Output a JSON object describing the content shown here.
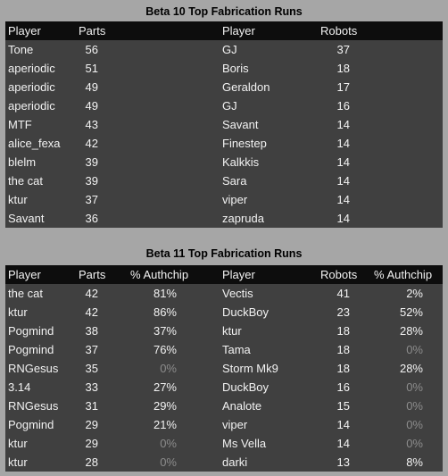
{
  "beta10": {
    "title": "Beta 10 Top Fabrication Runs",
    "headers": {
      "player": "Player",
      "parts": "Parts",
      "player2": "Player",
      "robots": "Robots"
    },
    "rows": [
      {
        "player": "Tone",
        "parts": "56",
        "player2": "GJ",
        "robots": "37"
      },
      {
        "player": "aperiodic",
        "parts": "51",
        "player2": "Boris",
        "robots": "18"
      },
      {
        "player": "aperiodic",
        "parts": "49",
        "player2": "Geraldon",
        "robots": "17"
      },
      {
        "player": "aperiodic",
        "parts": "49",
        "player2": "GJ",
        "robots": "16"
      },
      {
        "player": "MTF",
        "parts": "43",
        "player2": "Savant",
        "robots": "14"
      },
      {
        "player": "alice_fexa",
        "parts": "42",
        "player2": "Finestep",
        "robots": "14"
      },
      {
        "player": "blelm",
        "parts": "39",
        "player2": "Kalkkis",
        "robots": "14"
      },
      {
        "player": "the cat",
        "parts": "39",
        "player2": "Sara",
        "robots": "14"
      },
      {
        "player": "ktur",
        "parts": "37",
        "player2": "viper",
        "robots": "14"
      },
      {
        "player": "Savant",
        "parts": "36",
        "player2": "zapruda",
        "robots": "14"
      }
    ]
  },
  "beta11": {
    "title": "Beta 11 Top Fabrication Runs",
    "headers": {
      "player": "Player",
      "parts": "Parts",
      "authchip": "% Authchip",
      "player2": "Player",
      "robots": "Robots",
      "authchip2": "% Authchip"
    },
    "rows": [
      {
        "player": "the cat",
        "parts": "42",
        "authchip": "81%",
        "player2": "Vectis",
        "robots": "41",
        "authchip2": "2%"
      },
      {
        "player": "ktur",
        "parts": "42",
        "authchip": "86%",
        "player2": "DuckBoy",
        "robots": "23",
        "authchip2": "52%"
      },
      {
        "player": "Pogmind",
        "parts": "38",
        "authchip": "37%",
        "player2": "ktur",
        "robots": "18",
        "authchip2": "28%"
      },
      {
        "player": "Pogmind",
        "parts": "37",
        "authchip": "76%",
        "player2": "Tama",
        "robots": "18",
        "authchip2": "0%"
      },
      {
        "player": "RNGesus",
        "parts": "35",
        "authchip": "0%",
        "player2": "Storm Mk9",
        "robots": "18",
        "authchip2": "28%"
      },
      {
        "player": "3.14",
        "parts": "33",
        "authchip": "27%",
        "player2": "DuckBoy",
        "robots": "16",
        "authchip2": "0%"
      },
      {
        "player": "RNGesus",
        "parts": "31",
        "authchip": "29%",
        "player2": "Analote",
        "robots": "15",
        "authchip2": "0%"
      },
      {
        "player": "Pogmind",
        "parts": "29",
        "authchip": "21%",
        "player2": "viper",
        "robots": "14",
        "authchip2": "0%"
      },
      {
        "player": "ktur",
        "parts": "29",
        "authchip": "0%",
        "player2": "Ms Vella",
        "robots": "14",
        "authchip2": "0%"
      },
      {
        "player": "ktur",
        "parts": "28",
        "authchip": "0%",
        "player2": "darki",
        "robots": "13",
        "authchip2": "8%"
      }
    ]
  }
}
